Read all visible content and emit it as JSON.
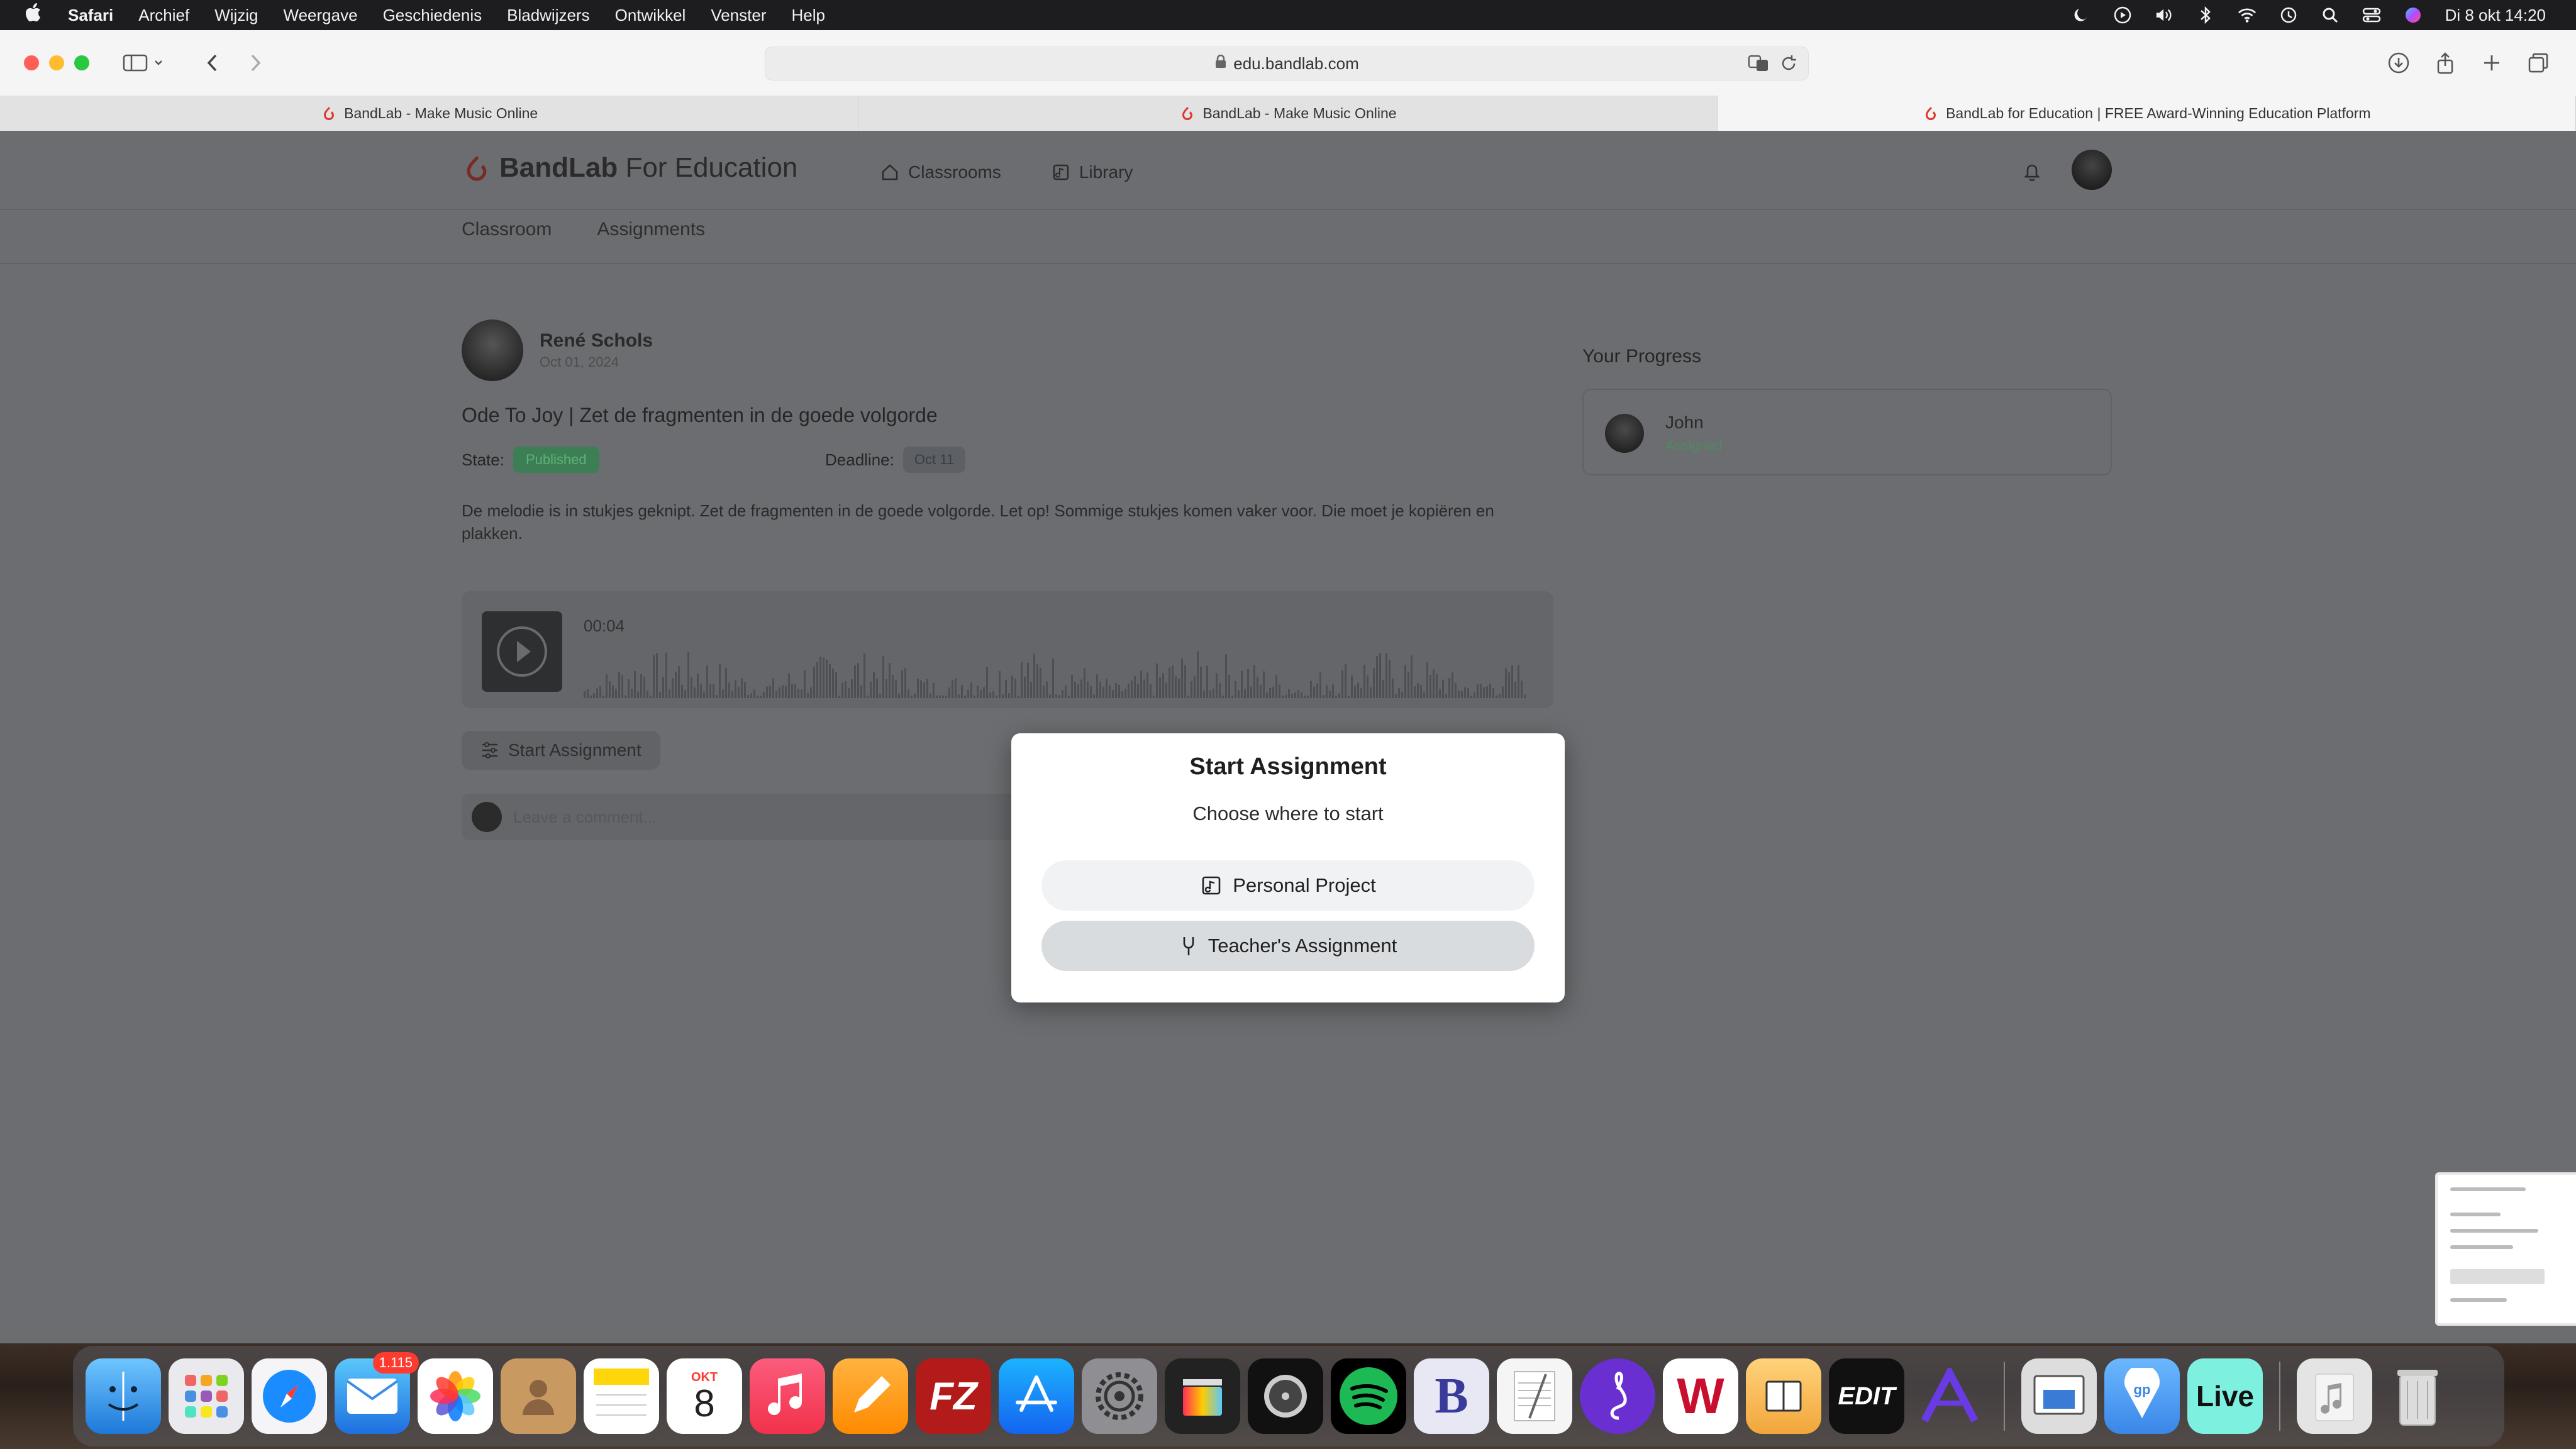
{
  "menubar": {
    "app_name": "Safari",
    "items": [
      "Archief",
      "Wijzig",
      "Weergave",
      "Geschiedenis",
      "Bladwijzers",
      "Ontwikkel",
      "Venster",
      "Help"
    ],
    "clock": "Di 8 okt  14:20"
  },
  "browser": {
    "url": "edu.bandlab.com",
    "tabs": [
      {
        "title": "BandLab - Make Music Online"
      },
      {
        "title": "BandLab - Make Music Online"
      },
      {
        "title": "BandLab for Education | FREE Award-Winning Education Platform"
      }
    ]
  },
  "site": {
    "logo_bold": "BandLab",
    "logo_light": " For Education",
    "nav": [
      "Classrooms",
      "Library"
    ],
    "subnav": [
      "Classroom",
      "Assignments"
    ]
  },
  "assignment": {
    "author": "René Schols",
    "date": "Oct 01, 2024",
    "title": "Ode To Joy | Zet de fragmenten in de goede volgorde",
    "state_label": "State:",
    "state_value": "Published",
    "deadline_label": "Deadline:",
    "deadline_value": "Oct 11",
    "description": "De melodie is in stukjes geknipt. Zet de fragmenten in de goede volgorde. Let op! Sommige stukjes komen vaker voor. Die moet je kopiëren en plakken.",
    "player_time": "00:04",
    "start_label": "Start Assignment",
    "comment_placeholder": "Leave a comment..."
  },
  "progress": {
    "title": "Your Progress",
    "student_name": "John",
    "student_status": "Assigned"
  },
  "modal": {
    "title": "Start Assignment",
    "subtitle": "Choose where to start",
    "option_personal": "Personal Project",
    "option_teacher": "Teacher's Assignment"
  },
  "dock": {
    "mail_badge": "1.115",
    "calendar_month": "OKT",
    "calendar_day": "8"
  },
  "colors": {
    "overlay": "#6b6d70",
    "brand_red": "#e0362b",
    "published": "#3d7f54"
  }
}
